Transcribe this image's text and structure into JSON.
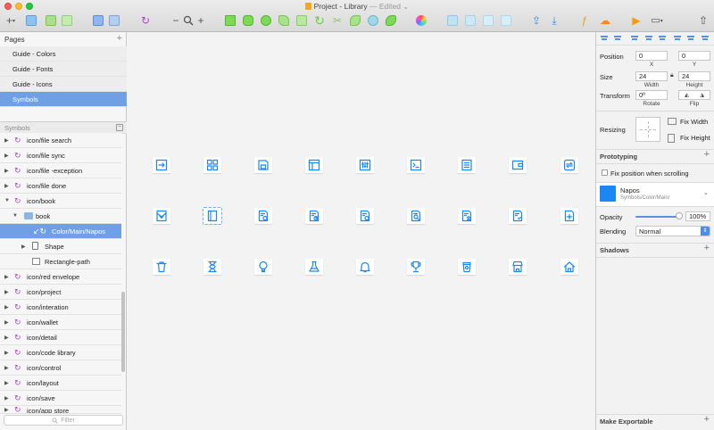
{
  "window": {
    "title": "Project - Library",
    "edited": "— Edited"
  },
  "toolbar": {
    "zoom_minus": "−",
    "zoom_plus": "+",
    "add": "+"
  },
  "pages": {
    "header": "Pages",
    "items": [
      {
        "label": "Guide - Colors"
      },
      {
        "label": "Guide - Fonts"
      },
      {
        "label": "Guide - Icons"
      },
      {
        "label": "Symbols"
      }
    ]
  },
  "layers": {
    "header": "Symbols",
    "items": [
      {
        "label": "icon/file search"
      },
      {
        "label": "icon/file sync"
      },
      {
        "label": "icon/file -exception"
      },
      {
        "label": "icon/file done"
      },
      {
        "label": "icon/book"
      },
      {
        "label": "book"
      },
      {
        "label": "Color/Main/Napos"
      },
      {
        "label": "Shape"
      },
      {
        "label": "Rectangle-path"
      },
      {
        "label": "icon/red envelope"
      },
      {
        "label": "icon/project"
      },
      {
        "label": "icon/interation"
      },
      {
        "label": "icon/wallet"
      },
      {
        "label": "icon/detail"
      },
      {
        "label": "icon/code library"
      },
      {
        "label": "icon/control"
      },
      {
        "label": "icon/layout"
      },
      {
        "label": "icon/save"
      },
      {
        "label": "icon/app store"
      }
    ],
    "filter_placeholder": "Filter"
  },
  "inspector": {
    "position_label": "Position",
    "x_value": "0",
    "y_value": "0",
    "x_label": "X",
    "y_label": "Y",
    "size_label": "Size",
    "width_value": "24",
    "height_value": "24",
    "width_label": "Width",
    "height_label": "Height",
    "transform_label": "Transform",
    "rotate_value": "0º",
    "rotate_label": "Rotate",
    "flip_label": "Flip",
    "resizing_label": "Resizing",
    "fix_width": "Fix Width",
    "fix_height": "Fix Height",
    "prototyping": "Prototyping",
    "fix_scroll": "Fix position when scrolling",
    "symbol_name": "Napos",
    "symbol_path": "Symbols/Color/Main/",
    "symbol_color": "#1a87f5",
    "opacity_label": "Opacity",
    "opacity_value": "100%",
    "opacity": 1.0,
    "blending_label": "Blending",
    "blending_value": "Normal",
    "shadows": "Shadows",
    "make_exportable": "Make Exportable"
  },
  "canvas": {
    "icon_color": "#1a87f5",
    "rows": [
      [
        "export-icon",
        "grid-icon",
        "save-icon",
        "layout-icon",
        "control-icon",
        "code-icon",
        "list-icon",
        "wallet-icon",
        "sync-icon"
      ],
      [
        "envelope-icon",
        "book-icon",
        "file-done-icon",
        "file-time-icon",
        "file-exception-icon",
        "file-search-icon",
        "file-user-icon",
        "file-check-icon",
        "file-add-icon"
      ],
      [
        "trash-icon",
        "hourglass-icon",
        "bulb-icon",
        "flask-icon",
        "bell-icon",
        "trophy-icon",
        "cup-icon",
        "store-icon",
        "home-icon"
      ]
    ]
  }
}
